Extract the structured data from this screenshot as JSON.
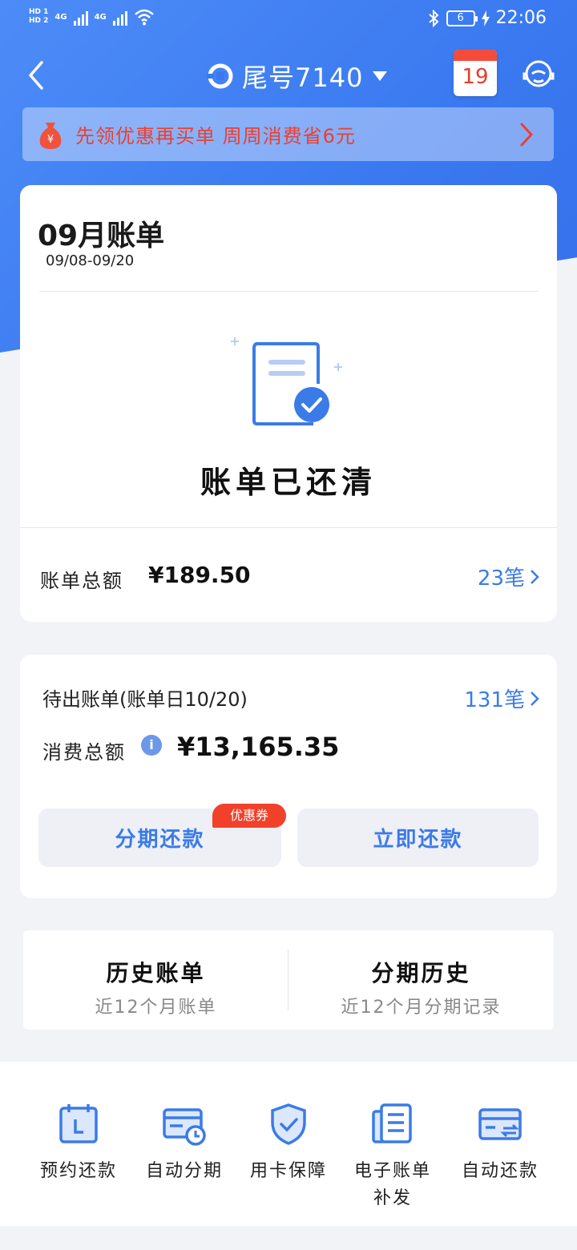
{
  "status_bar": {
    "hd1": "HD 1",
    "hd2": "HD 2",
    "net1": "4G",
    "net2": "4G",
    "battery": "6",
    "time": "22:06"
  },
  "nav": {
    "title": "尾号7140",
    "calendar_day": "19"
  },
  "promo": {
    "text": "先领优惠再买单 周周消费省6元"
  },
  "bill": {
    "title": "09月账单",
    "range": "09/08-09/20",
    "status": "账单已还清",
    "total_label": "账单总额",
    "total_value": "¥189.50",
    "total_count": "23笔"
  },
  "pending": {
    "label": "待出账单(账单日10/20)",
    "count": "131笔",
    "spend_label": "消费总额",
    "spend_value": "¥13,165.35",
    "install_button": "分期还款",
    "coupon_badge": "优惠券",
    "repay_button": "立即还款"
  },
  "history": {
    "bill_history_title": "历史账单",
    "bill_history_sub": "近12个月账单",
    "install_history_title": "分期历史",
    "install_history_sub": "近12个月分期记录"
  },
  "features": [
    {
      "label": "预约还款",
      "icon": "calendar-icon"
    },
    {
      "label": "自动分期",
      "icon": "card-clock-icon"
    },
    {
      "label": "用卡保障",
      "icon": "shield-check-icon"
    },
    {
      "label": "电子账单补发",
      "icon": "document-icon"
    },
    {
      "label": "自动还款",
      "icon": "card-refresh-icon"
    }
  ],
  "colors": {
    "brand_blue": "#3a79f0",
    "accent_blue": "#3b7be8",
    "promo_red": "#ec3f2f"
  }
}
